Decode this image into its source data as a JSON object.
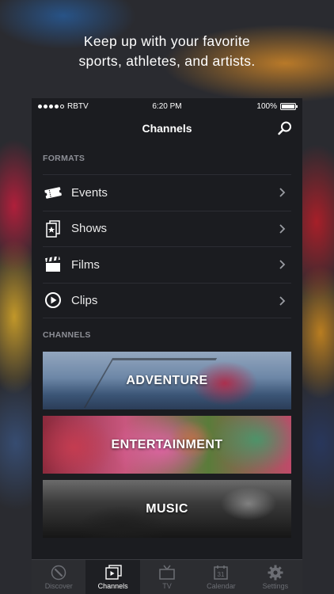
{
  "headline": {
    "line1": "Keep up with your favorite",
    "line2": "sports, athletes, and artists."
  },
  "status_bar": {
    "carrier": "RBTV",
    "time": "6:20 PM",
    "battery": "100%"
  },
  "nav": {
    "title": "Channels"
  },
  "formats": {
    "label": "FORMATS",
    "items": [
      {
        "label": "Events",
        "icon": "ticket-icon"
      },
      {
        "label": "Shows",
        "icon": "show-icon"
      },
      {
        "label": "Films",
        "icon": "clapperboard-icon"
      },
      {
        "label": "Clips",
        "icon": "play-circle-icon"
      }
    ]
  },
  "channels": {
    "label": "CHANNELS",
    "items": [
      {
        "label": "ADVENTURE"
      },
      {
        "label": "ENTERTAINMENT"
      },
      {
        "label": "MUSIC"
      }
    ]
  },
  "tabs": [
    {
      "label": "Discover",
      "icon": "compass-icon",
      "active": false
    },
    {
      "label": "Channels",
      "icon": "channels-icon",
      "active": true
    },
    {
      "label": "TV",
      "icon": "tv-icon",
      "active": false
    },
    {
      "label": "Calendar",
      "icon": "calendar-icon",
      "active": false,
      "badge": "31"
    },
    {
      "label": "Settings",
      "icon": "gear-icon",
      "active": false
    }
  ]
}
